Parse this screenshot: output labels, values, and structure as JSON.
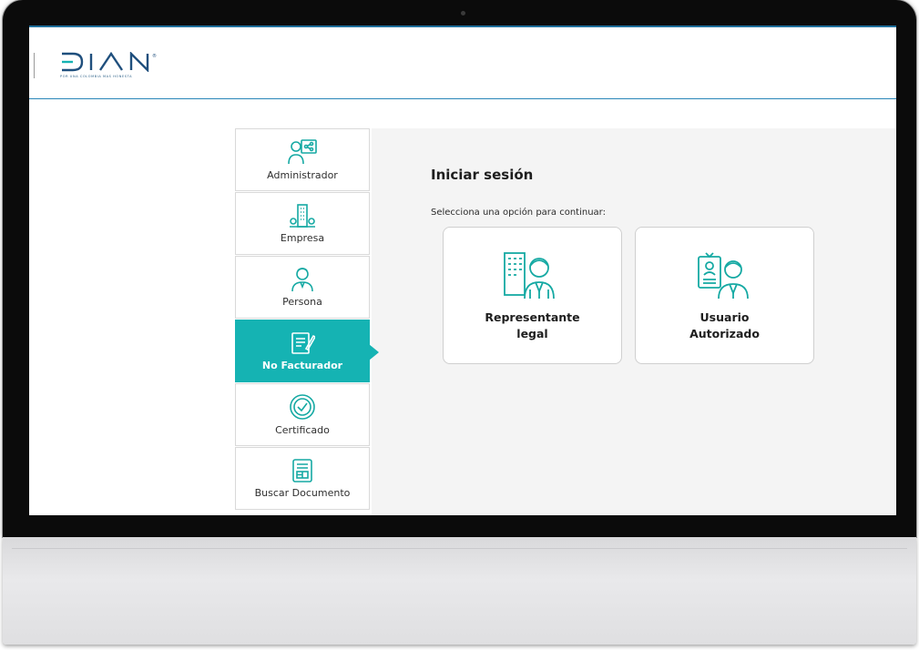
{
  "brand": {
    "logo_text": "DIAN",
    "tagline": "POR UNA COLOMBIA MAS HONESTA",
    "accent": "#15b3b3",
    "header_line": "#2a86b8"
  },
  "sidebar": {
    "items": [
      {
        "label": "Administrador",
        "icon": "admin-icon"
      },
      {
        "label": "Empresa",
        "icon": "building-icon"
      },
      {
        "label": "Persona",
        "icon": "person-icon"
      },
      {
        "label": "No Facturador",
        "icon": "document-edit-icon",
        "active": true
      },
      {
        "label": "Certificado",
        "icon": "certificate-icon"
      },
      {
        "label": "Buscar Documento",
        "icon": "search-document-icon"
      }
    ]
  },
  "main": {
    "title": "Iniciar sesión",
    "subtitle": "Selecciona una opción para continuar:",
    "options": [
      {
        "label": "Representante\nlegal",
        "icon": "legal-representative-icon"
      },
      {
        "label": "Usuario\nAutorizado",
        "icon": "authorized-user-icon"
      }
    ]
  }
}
